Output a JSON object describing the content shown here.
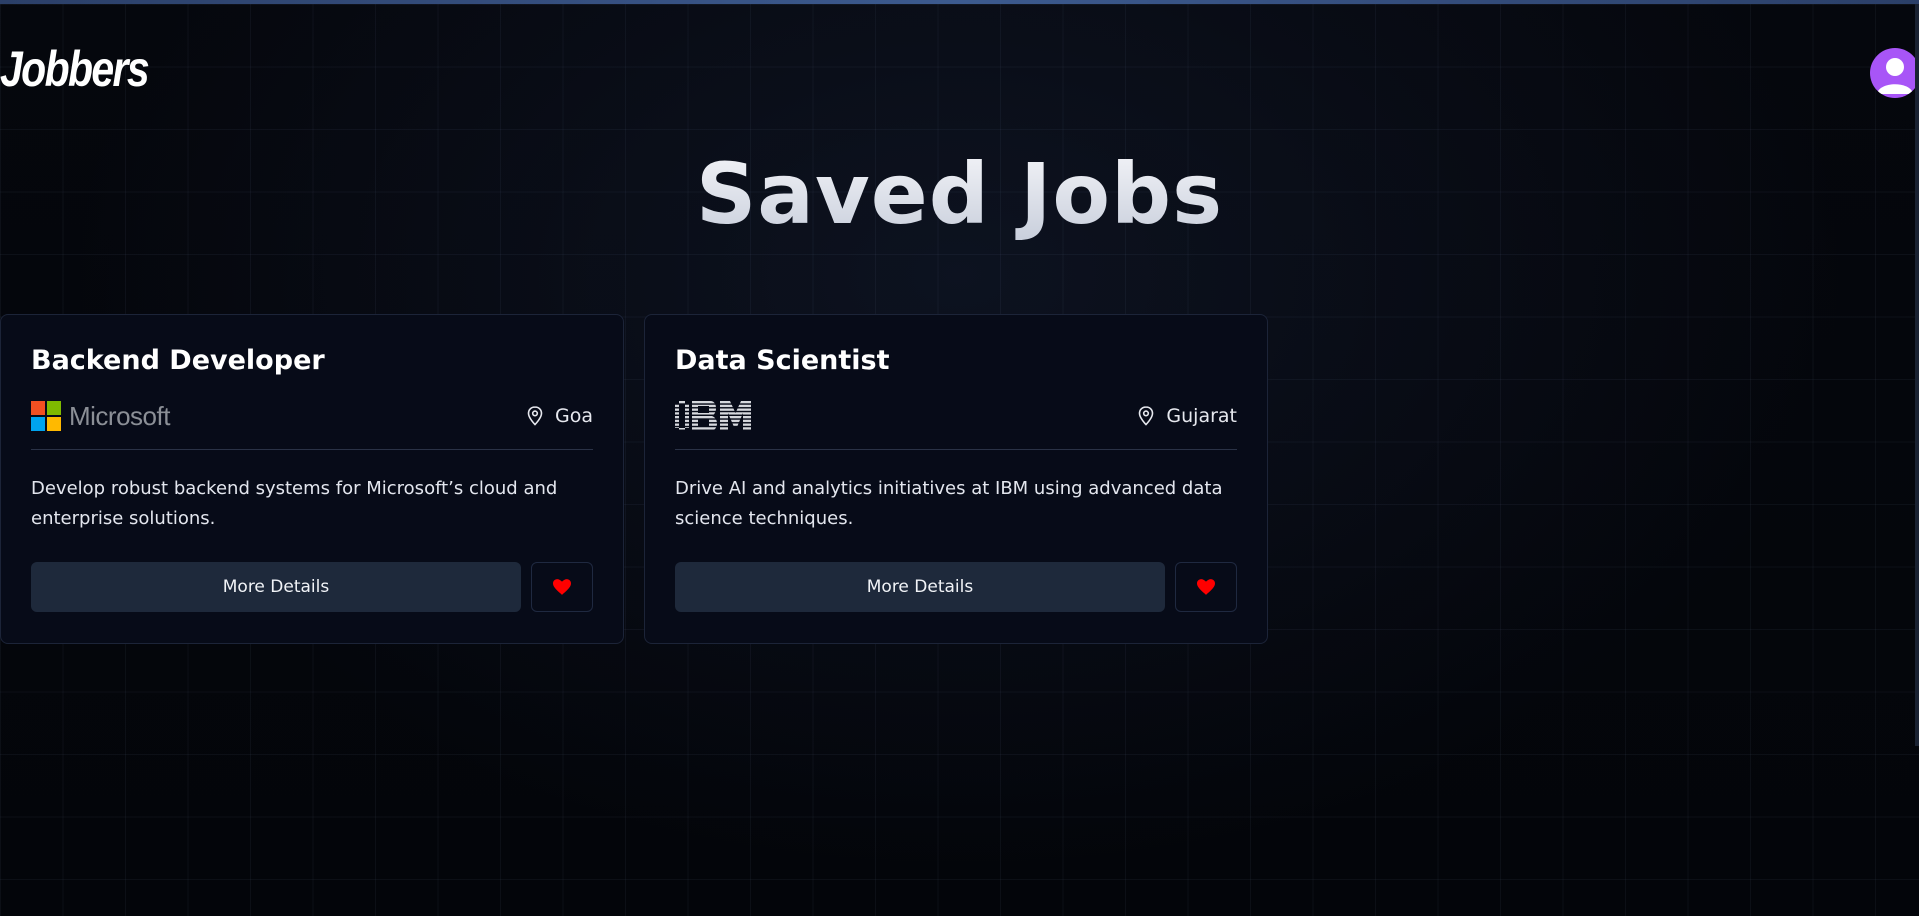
{
  "header": {
    "logo_text": "Jobbers"
  },
  "main": {
    "title": "Saved Jobs",
    "jobs": [
      {
        "title": "Backend Developer",
        "company": "Microsoft",
        "location": "Goa",
        "description": "Develop robust backend systems for Microsoft’s cloud and enterprise solutions.",
        "details_label": "More Details"
      },
      {
        "title": "Data Scientist",
        "company": "IBM",
        "location": "Gujarat",
        "description": "Drive AI and analytics initiatives at IBM using advanced data science techniques.",
        "details_label": "More Details"
      }
    ]
  },
  "icons": {
    "location": "map-pin-icon",
    "saved": "heart-icon",
    "avatar": "user-icon"
  },
  "colors": {
    "background": "#05070d",
    "card": "#070b18",
    "button": "#1e293b",
    "heart": "#ff0000",
    "avatar": "#a855f7"
  }
}
